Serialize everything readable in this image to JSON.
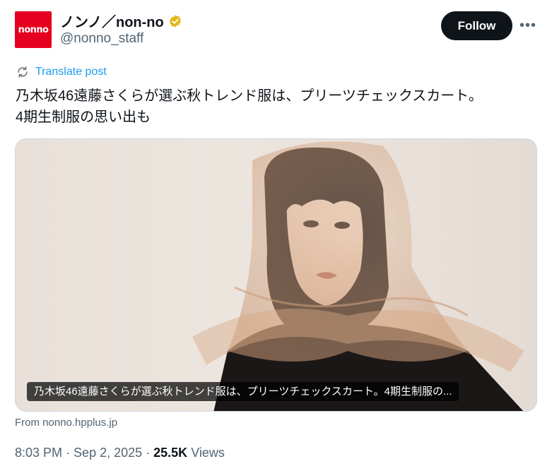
{
  "author": {
    "avatar_text": "nonno",
    "display_name": "ノンノ／non-no",
    "handle": "@nonno_staff",
    "verified_color": "#e2b719"
  },
  "actions": {
    "follow_label": "Follow",
    "more_label": "•••"
  },
  "translate": {
    "label": "Translate post",
    "color": "#1d9bf0"
  },
  "post": {
    "text_line1": "乃木坂46遠藤さくらが選ぶ秋トレンド服は、プリーツチェックスカート。",
    "text_line2": "4期生制服の思い出も"
  },
  "media": {
    "caption": "乃木坂46遠藤さくらが選ぶ秋トレンド服は、プリーツチェックスカート。4期生制服の..."
  },
  "link_source": "From nonno.hpplus.jp",
  "meta": {
    "time": "8:03 PM",
    "separator": " · ",
    "date": "Sep 2, 2025",
    "views_count": "25.5K",
    "views_label": "Views"
  }
}
